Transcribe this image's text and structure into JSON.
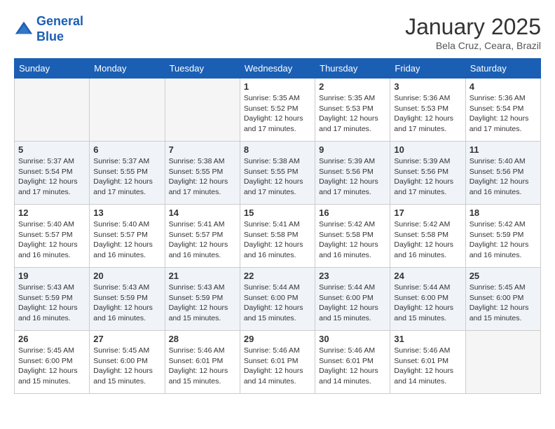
{
  "header": {
    "logo_line1": "General",
    "logo_line2": "Blue",
    "month": "January 2025",
    "location": "Bela Cruz, Ceara, Brazil"
  },
  "weekdays": [
    "Sunday",
    "Monday",
    "Tuesday",
    "Wednesday",
    "Thursday",
    "Friday",
    "Saturday"
  ],
  "weeks": [
    [
      {
        "day": "",
        "info": "",
        "shade": true
      },
      {
        "day": "",
        "info": "",
        "shade": true
      },
      {
        "day": "",
        "info": "",
        "shade": true
      },
      {
        "day": "1",
        "info": "Sunrise: 5:35 AM\nSunset: 5:52 PM\nDaylight: 12 hours\nand 17 minutes.",
        "shade": false
      },
      {
        "day": "2",
        "info": "Sunrise: 5:35 AM\nSunset: 5:53 PM\nDaylight: 12 hours\nand 17 minutes.",
        "shade": false
      },
      {
        "day": "3",
        "info": "Sunrise: 5:36 AM\nSunset: 5:53 PM\nDaylight: 12 hours\nand 17 minutes.",
        "shade": false
      },
      {
        "day": "4",
        "info": "Sunrise: 5:36 AM\nSunset: 5:54 PM\nDaylight: 12 hours\nand 17 minutes.",
        "shade": false
      }
    ],
    [
      {
        "day": "5",
        "info": "Sunrise: 5:37 AM\nSunset: 5:54 PM\nDaylight: 12 hours\nand 17 minutes.",
        "shade": true
      },
      {
        "day": "6",
        "info": "Sunrise: 5:37 AM\nSunset: 5:55 PM\nDaylight: 12 hours\nand 17 minutes.",
        "shade": true
      },
      {
        "day": "7",
        "info": "Sunrise: 5:38 AM\nSunset: 5:55 PM\nDaylight: 12 hours\nand 17 minutes.",
        "shade": true
      },
      {
        "day": "8",
        "info": "Sunrise: 5:38 AM\nSunset: 5:55 PM\nDaylight: 12 hours\nand 17 minutes.",
        "shade": true
      },
      {
        "day": "9",
        "info": "Sunrise: 5:39 AM\nSunset: 5:56 PM\nDaylight: 12 hours\nand 17 minutes.",
        "shade": true
      },
      {
        "day": "10",
        "info": "Sunrise: 5:39 AM\nSunset: 5:56 PM\nDaylight: 12 hours\nand 17 minutes.",
        "shade": true
      },
      {
        "day": "11",
        "info": "Sunrise: 5:40 AM\nSunset: 5:56 PM\nDaylight: 12 hours\nand 16 minutes.",
        "shade": true
      }
    ],
    [
      {
        "day": "12",
        "info": "Sunrise: 5:40 AM\nSunset: 5:57 PM\nDaylight: 12 hours\nand 16 minutes.",
        "shade": false
      },
      {
        "day": "13",
        "info": "Sunrise: 5:40 AM\nSunset: 5:57 PM\nDaylight: 12 hours\nand 16 minutes.",
        "shade": false
      },
      {
        "day": "14",
        "info": "Sunrise: 5:41 AM\nSunset: 5:57 PM\nDaylight: 12 hours\nand 16 minutes.",
        "shade": false
      },
      {
        "day": "15",
        "info": "Sunrise: 5:41 AM\nSunset: 5:58 PM\nDaylight: 12 hours\nand 16 minutes.",
        "shade": false
      },
      {
        "day": "16",
        "info": "Sunrise: 5:42 AM\nSunset: 5:58 PM\nDaylight: 12 hours\nand 16 minutes.",
        "shade": false
      },
      {
        "day": "17",
        "info": "Sunrise: 5:42 AM\nSunset: 5:58 PM\nDaylight: 12 hours\nand 16 minutes.",
        "shade": false
      },
      {
        "day": "18",
        "info": "Sunrise: 5:42 AM\nSunset: 5:59 PM\nDaylight: 12 hours\nand 16 minutes.",
        "shade": false
      }
    ],
    [
      {
        "day": "19",
        "info": "Sunrise: 5:43 AM\nSunset: 5:59 PM\nDaylight: 12 hours\nand 16 minutes.",
        "shade": true
      },
      {
        "day": "20",
        "info": "Sunrise: 5:43 AM\nSunset: 5:59 PM\nDaylight: 12 hours\nand 16 minutes.",
        "shade": true
      },
      {
        "day": "21",
        "info": "Sunrise: 5:43 AM\nSunset: 5:59 PM\nDaylight: 12 hours\nand 15 minutes.",
        "shade": true
      },
      {
        "day": "22",
        "info": "Sunrise: 5:44 AM\nSunset: 6:00 PM\nDaylight: 12 hours\nand 15 minutes.",
        "shade": true
      },
      {
        "day": "23",
        "info": "Sunrise: 5:44 AM\nSunset: 6:00 PM\nDaylight: 12 hours\nand 15 minutes.",
        "shade": true
      },
      {
        "day": "24",
        "info": "Sunrise: 5:44 AM\nSunset: 6:00 PM\nDaylight: 12 hours\nand 15 minutes.",
        "shade": true
      },
      {
        "day": "25",
        "info": "Sunrise: 5:45 AM\nSunset: 6:00 PM\nDaylight: 12 hours\nand 15 minutes.",
        "shade": true
      }
    ],
    [
      {
        "day": "26",
        "info": "Sunrise: 5:45 AM\nSunset: 6:00 PM\nDaylight: 12 hours\nand 15 minutes.",
        "shade": false
      },
      {
        "day": "27",
        "info": "Sunrise: 5:45 AM\nSunset: 6:00 PM\nDaylight: 12 hours\nand 15 minutes.",
        "shade": false
      },
      {
        "day": "28",
        "info": "Sunrise: 5:46 AM\nSunset: 6:01 PM\nDaylight: 12 hours\nand 15 minutes.",
        "shade": false
      },
      {
        "day": "29",
        "info": "Sunrise: 5:46 AM\nSunset: 6:01 PM\nDaylight: 12 hours\nand 14 minutes.",
        "shade": false
      },
      {
        "day": "30",
        "info": "Sunrise: 5:46 AM\nSunset: 6:01 PM\nDaylight: 12 hours\nand 14 minutes.",
        "shade": false
      },
      {
        "day": "31",
        "info": "Sunrise: 5:46 AM\nSunset: 6:01 PM\nDaylight: 12 hours\nand 14 minutes.",
        "shade": false
      },
      {
        "day": "",
        "info": "",
        "shade": false
      }
    ]
  ]
}
